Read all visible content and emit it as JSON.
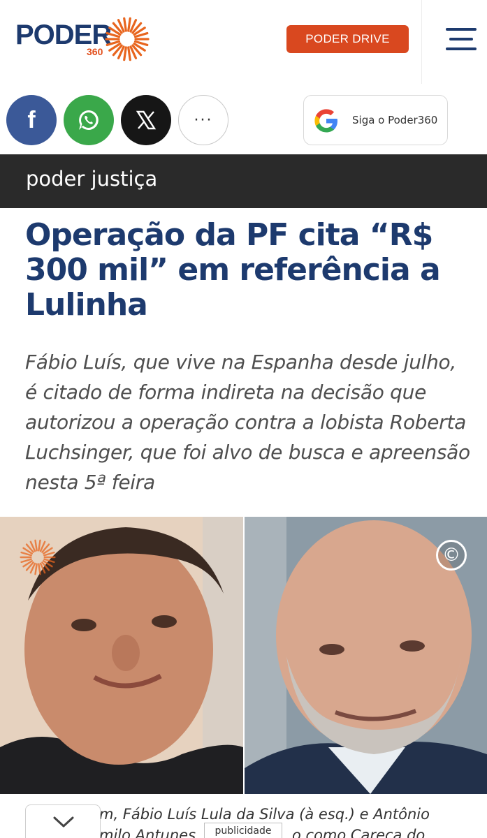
{
  "header": {
    "logo_text": "PODER",
    "logo_sub": "360",
    "drive_button": "PODER DRIVE",
    "menu_icon": "hamburger-menu-icon"
  },
  "share": {
    "facebook_icon": "facebook-icon",
    "facebook_glyph": "f",
    "whatsapp_icon": "whatsapp-icon",
    "x_icon": "x-icon",
    "more_icon": "more-icon",
    "more_glyph": "···",
    "google_button": "Siga o Poder360",
    "google_icon": "google-icon"
  },
  "section": {
    "label": "poder justiça"
  },
  "article": {
    "headline": "Operação da PF cita “R$ 300 mil” em referência a Lulinha",
    "subtitle": "Fábio Luís, que vive na Espanha desde julho, é citado de forma indireta na decisão que autorizou a operação contra a lobista Roberta Luchsinger, que foi alvo de busca e apreensão nesta 5ª feira",
    "copyright_glyph": "©",
    "caption_line1": "m, Fábio Luís Lula da Silva (à esq.) e Antônio",
    "caption_line2": "milo Antunes,",
    "caption_line2_end": "o como Careca do",
    "ad_label": "publicidade"
  },
  "colors": {
    "brand_blue": "#1d3a6e",
    "brand_orange": "#d9481f",
    "section_bg": "#2a2a2a"
  }
}
